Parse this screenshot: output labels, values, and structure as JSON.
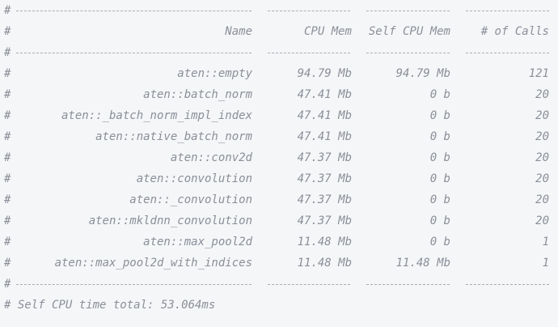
{
  "comment_prefix": "#",
  "header": {
    "name": "Name",
    "cpu_mem": "CPU Mem",
    "self_cpu_mem": "Self CPU Mem",
    "calls": "# of Calls"
  },
  "rows": [
    {
      "name": "aten::empty",
      "cpu_mem": "94.79 Mb",
      "self_cpu_mem": "94.79 Mb",
      "calls": "121"
    },
    {
      "name": "aten::batch_norm",
      "cpu_mem": "47.41 Mb",
      "self_cpu_mem": "0 b",
      "calls": "20"
    },
    {
      "name": "aten::_batch_norm_impl_index",
      "cpu_mem": "47.41 Mb",
      "self_cpu_mem": "0 b",
      "calls": "20"
    },
    {
      "name": "aten::native_batch_norm",
      "cpu_mem": "47.41 Mb",
      "self_cpu_mem": "0 b",
      "calls": "20"
    },
    {
      "name": "aten::conv2d",
      "cpu_mem": "47.37 Mb",
      "self_cpu_mem": "0 b",
      "calls": "20"
    },
    {
      "name": "aten::convolution",
      "cpu_mem": "47.37 Mb",
      "self_cpu_mem": "0 b",
      "calls": "20"
    },
    {
      "name": "aten::_convolution",
      "cpu_mem": "47.37 Mb",
      "self_cpu_mem": "0 b",
      "calls": "20"
    },
    {
      "name": "aten::mkldnn_convolution",
      "cpu_mem": "47.37 Mb",
      "self_cpu_mem": "0 b",
      "calls": "20"
    },
    {
      "name": "aten::max_pool2d",
      "cpu_mem": "11.48 Mb",
      "self_cpu_mem": "0 b",
      "calls": "1"
    },
    {
      "name": "aten::max_pool2d_with_indices",
      "cpu_mem": "11.48 Mb",
      "self_cpu_mem": "11.48 Mb",
      "calls": "1"
    }
  ],
  "footer": {
    "total": "# Self CPU time total: 53.064ms"
  }
}
